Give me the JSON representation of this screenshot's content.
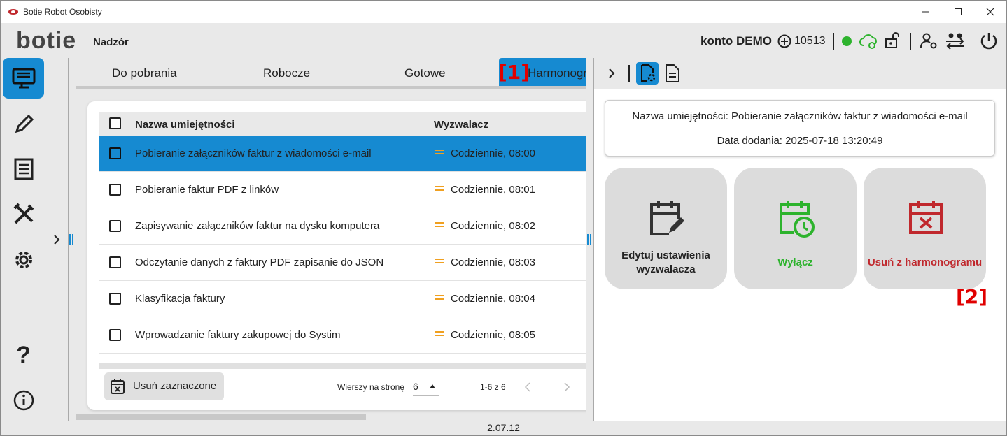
{
  "window": {
    "title": "Botie Robot Osobisty"
  },
  "header": {
    "logo": "botie",
    "section": "Nadzór",
    "account": "konto DEMO",
    "credits": "10513"
  },
  "tabs": [
    {
      "label": "Do pobrania"
    },
    {
      "label": "Robocze"
    },
    {
      "label": "Gotowe"
    },
    {
      "label": "Harmonogram"
    }
  ],
  "markers": {
    "m1": "[1]",
    "m2": "[2]"
  },
  "table": {
    "headers": {
      "name": "Nazwa umiejętności",
      "trigger": "Wyzwalacz"
    },
    "rows": [
      {
        "name": "Pobieranie załączników faktur z wiadomości e-mail",
        "trigger": "Codziennie, 08:00",
        "selected": true
      },
      {
        "name": "Pobieranie faktur PDF z linków",
        "trigger": "Codziennie, 08:01"
      },
      {
        "name": "Zapisywanie załączników faktur na dysku komputera",
        "trigger": "Codziennie, 08:02"
      },
      {
        "name": "Odczytanie danych z faktury PDF zapisanie do JSON",
        "trigger": "Codziennie, 08:03"
      },
      {
        "name": "Klasyfikacja faktury",
        "trigger": "Codziennie, 08:04"
      },
      {
        "name": "Wprowadzanie faktury zakupowej do Systim",
        "trigger": "Codziennie, 08:05"
      }
    ],
    "footer": {
      "delete_selected": "Usuń zaznaczone",
      "rows_per_page_label": "Wierszy na stronę",
      "rows_per_page": "6",
      "range": "1-6 z 6"
    }
  },
  "detail": {
    "skill_name_line": "Nazwa umiejętności: Pobieranie załączników faktur z wiadomości e-mail",
    "added_line": "Data dodania: 2025-07-18 13:20:49",
    "actions": {
      "edit_line1": "Edytuj ustawienia",
      "edit_line2": "wyzwalacza",
      "disable": "Wyłącz",
      "remove": "Usuń z harmonogramu"
    }
  },
  "version": "2.07.12",
  "colors": {
    "accent": "#168ad1",
    "green": "#2db32d",
    "red": "#c0282d",
    "orange": "#f0a020"
  }
}
